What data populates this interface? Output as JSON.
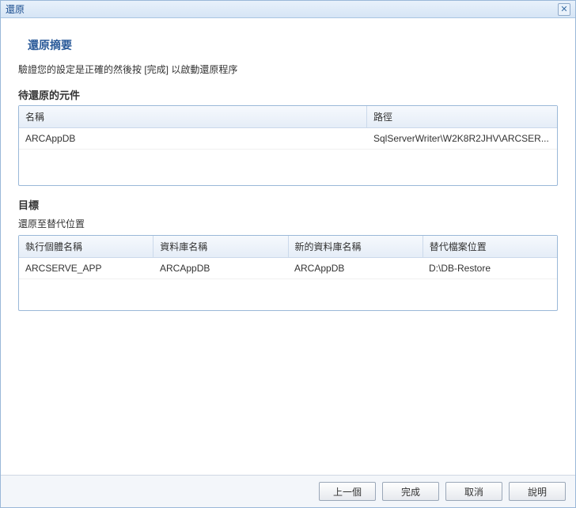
{
  "window": {
    "title": "還原"
  },
  "summary": {
    "heading": "還原摘要",
    "desc": "驗證您的設定是正確的然後按 [完成] 以啟動還原程序"
  },
  "components": {
    "heading": "待還原的元件",
    "columns": {
      "name": "名稱",
      "path": "路徑"
    },
    "rows": [
      {
        "name": "ARCAppDB",
        "path": "SqlServerWriter\\W2K8R2JHV\\ARCSER..."
      }
    ]
  },
  "destination": {
    "heading": "目標",
    "subtext": "還原至替代位置",
    "columns": {
      "instance": "執行個體名稱",
      "dbname": "資料庫名稱",
      "newdbname": "新的資料庫名稱",
      "altpath": "替代檔案位置"
    },
    "rows": [
      {
        "instance": "ARCSERVE_APP",
        "dbname": "ARCAppDB",
        "newdbname": "ARCAppDB",
        "altpath": "D:\\DB-Restore"
      }
    ]
  },
  "buttons": {
    "back": "上一個",
    "finish": "完成",
    "cancel": "取消",
    "help": "說明"
  }
}
